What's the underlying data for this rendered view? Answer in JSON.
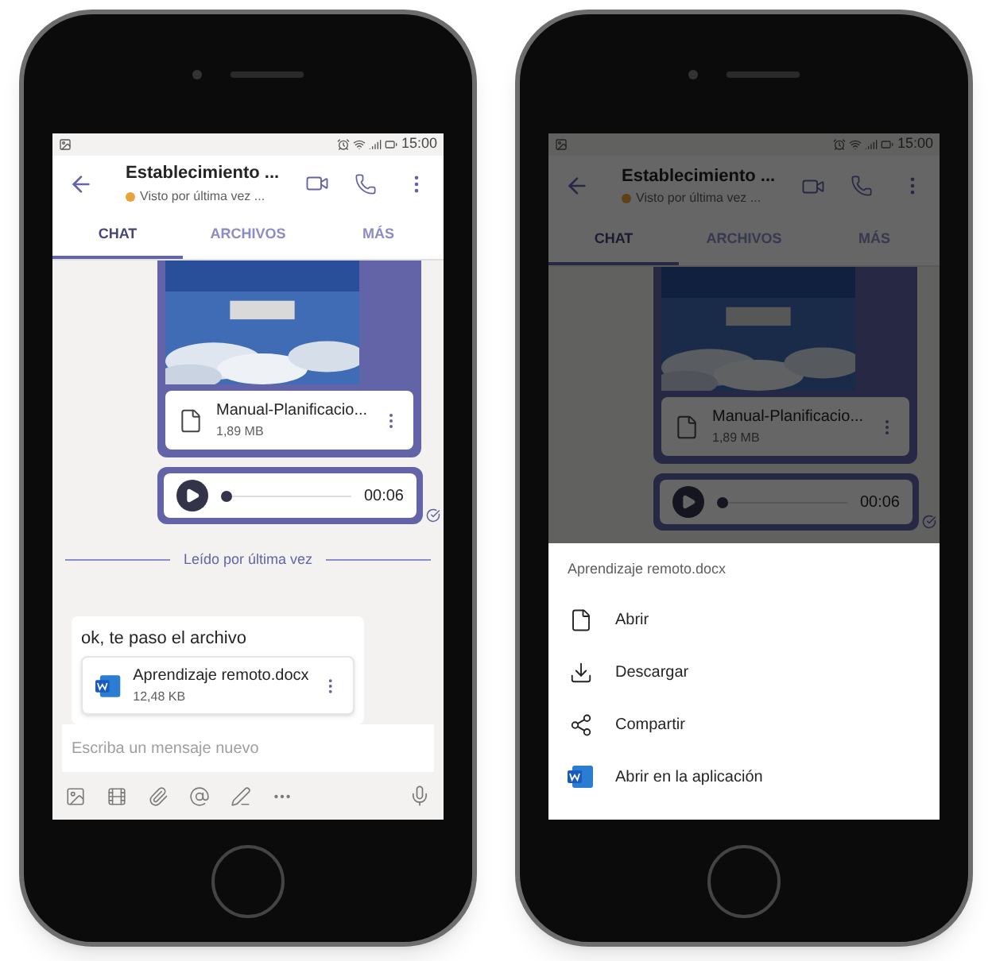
{
  "phones": [
    {
      "status_time": "15:00",
      "title": "Establecimiento ...",
      "presence": "Visto por última vez ...",
      "dimmed": false,
      "tabs": [
        {
          "label": "CHAT",
          "selected": true
        },
        {
          "label": "ARCHIVOS",
          "selected": false
        },
        {
          "label": "MÁS",
          "selected": false
        }
      ],
      "messages": [
        {
          "kind": "image_file",
          "file_name": "Manual-Planificacio...",
          "file_size": "1,89 MB"
        },
        {
          "kind": "audio",
          "time": "00:06",
          "level": 0,
          "read": true
        },
        {
          "kind": "divider",
          "text": "Leído por última vez"
        },
        {
          "kind": "text_file",
          "text": "ok, te paso el archivo",
          "file_name": "Aprendizaje remoto.docx",
          "file_size": "12,48 KB"
        }
      ],
      "compose": {
        "placeholder": "Escriba un mensaje nuevo"
      }
    },
    {
      "status_time": "15:00",
      "title": "Establecimiento ...",
      "presence": "Visto por última vez ...",
      "dimmed": true,
      "tabs": [
        {
          "label": "CHAT",
          "selected": true
        },
        {
          "label": "ARCHIVOS",
          "selected": false
        },
        {
          "label": "MÁS",
          "selected": false
        }
      ],
      "messages": [
        {
          "kind": "image_file",
          "file_name": "Manual-Planificacio...",
          "file_size": "1,89 MB"
        },
        {
          "kind": "audio",
          "time": "00:06",
          "level": 0,
          "read": true
        }
      ],
      "sheet": {
        "title": "Aprendizaje remoto.docx",
        "actions": [
          {
            "kind": "open",
            "label": "Abrir"
          },
          {
            "kind": "download",
            "label": "Descargar"
          },
          {
            "kind": "share",
            "label": "Compartir"
          },
          {
            "kind": "app",
            "label": "Abrir en la aplicación"
          }
        ]
      }
    }
  ]
}
